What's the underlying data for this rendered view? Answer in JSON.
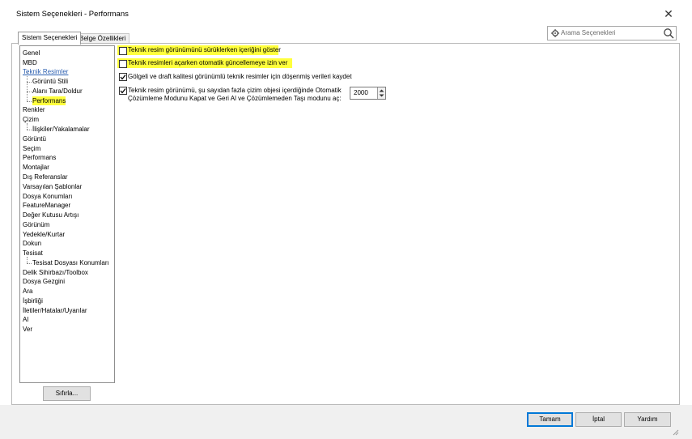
{
  "window": {
    "title": "Sistem Seçenekleri - Performans"
  },
  "tabs": [
    {
      "label": "Sistem Seçenekleri",
      "active": true
    },
    {
      "label": "Belge Özellikleri",
      "active": false
    }
  ],
  "search": {
    "placeholder": "Arama Seçenekleri"
  },
  "tree": {
    "items": [
      {
        "label": "Genel",
        "level": 0
      },
      {
        "label": "MBD",
        "level": 0
      },
      {
        "label": "Teknik Resimler",
        "level": 0,
        "link": true
      },
      {
        "label": "Görüntü Stili",
        "level": 1
      },
      {
        "label": "Alanı Tara/Doldur",
        "level": 1
      },
      {
        "label": "Performans",
        "level": 1,
        "selected": true
      },
      {
        "label": "Renkler",
        "level": 0
      },
      {
        "label": "Çizim",
        "level": 0
      },
      {
        "label": "İlişkiler/Yakalamalar",
        "level": 1
      },
      {
        "label": "Görüntü",
        "level": 0
      },
      {
        "label": "Seçim",
        "level": 0
      },
      {
        "label": "Performans",
        "level": 0
      },
      {
        "label": "Montajlar",
        "level": 0
      },
      {
        "label": "Dış Referanslar",
        "level": 0
      },
      {
        "label": "Varsayılan Şablonlar",
        "level": 0
      },
      {
        "label": "Dosya Konumları",
        "level": 0
      },
      {
        "label": "FeatureManager",
        "level": 0
      },
      {
        "label": "Değer Kutusu Artışı",
        "level": 0
      },
      {
        "label": "Görünüm",
        "level": 0
      },
      {
        "label": "Yedekle/Kurtar",
        "level": 0
      },
      {
        "label": "Dokun",
        "level": 0
      },
      {
        "label": "Tesisat",
        "level": 0
      },
      {
        "label": "Tesisat Dosyası Konumları",
        "level": 1
      },
      {
        "label": "Delik Sihirbazı/Toolbox",
        "level": 0
      },
      {
        "label": "Dosya Gezgini",
        "level": 0
      },
      {
        "label": "Ara",
        "level": 0
      },
      {
        "label": "İşbirliği",
        "level": 0
      },
      {
        "label": "İletiler/Hatalar/Uyarılar",
        "level": 0
      },
      {
        "label": "Al",
        "level": 0
      },
      {
        "label": "Ver",
        "level": 0
      }
    ],
    "reset_label": "Sıfırla..."
  },
  "options": [
    {
      "label": "Teknik resim görünümünü sürüklerken içeriğini göster",
      "checked": false,
      "highlighted": true
    },
    {
      "label": "Teknik resimleri açarken otomatik güncellemeye izin ver",
      "checked": false,
      "highlighted": true
    },
    {
      "label": "Gölgeli ve draft kalitesi görünümlü teknik resimler için döşenmiş verileri kaydet",
      "checked": true,
      "highlighted": false
    },
    {
      "label_line1": "Teknik resim görünümü, şu sayıdan fazla çizim objesi içerdiğinde Otomatik",
      "label_line2": "Çözümleme Modunu Kapat ve Geri Al ve Çözümlemeden Taşı modunu aç:",
      "checked": true,
      "highlighted": false,
      "value": "2000"
    }
  ],
  "buttons": {
    "ok": "Tamam",
    "cancel": "İptal",
    "help": "Yardım"
  },
  "colors": {
    "highlight": "#ffff3c",
    "link": "#2b5fb0",
    "accent": "#0078d7"
  }
}
